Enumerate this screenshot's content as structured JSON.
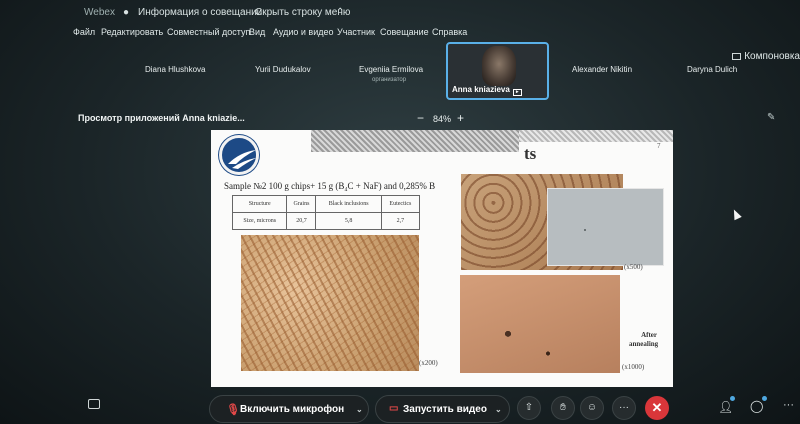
{
  "topbar": {
    "app_name": "Webex",
    "meeting_info": "Информация о совещании",
    "hide_menu": "Скрыть строку меню",
    "hide_menu_chevron": "chevron-up-icon"
  },
  "menubar": {
    "items": [
      "Файл",
      "Редактировать",
      "Совместный доступ",
      "Вид",
      "Аудио и видео",
      "Участник",
      "Совещание",
      "Справка"
    ]
  },
  "layout": {
    "label": "Компоновка",
    "icon": "layout-icon"
  },
  "participants": [
    {
      "name": "Diana Hlushkova",
      "role": ""
    },
    {
      "name": "Yurii Dudukalov",
      "role": ""
    },
    {
      "name": "Evgeniia Ermilova",
      "role": "организатор"
    },
    {
      "name": "Anna kniazieva",
      "role": ""
    },
    {
      "name": "Alexander Nikitin",
      "role": ""
    },
    {
      "name": "Daryna Dulich",
      "role": ""
    }
  ],
  "viewer": {
    "title": "Просмотр приложений Anna kniazie...",
    "zoom_minus": "−",
    "zoom_value": "84%",
    "zoom_plus": "+"
  },
  "slide": {
    "title_fragment": "ts",
    "page_number": "7",
    "sample_text": "Sample №2 100 g chips+ 15 g (B₄C + NaF) and 0,285% B",
    "table": {
      "row1": [
        "Structure",
        "Grains",
        "Black inclusions",
        "Eutectics"
      ],
      "row2": [
        "Size, microns",
        "20,7",
        "5,8",
        "2,7"
      ]
    },
    "caption_main": "(x200)",
    "caption_top_right": "(x500)",
    "caption_after": "After annealing",
    "caption_bottom_right": "(x1000)"
  },
  "controls": {
    "mic_label": "Включить микрофон",
    "video_label": "Запустить видео",
    "icons": [
      "chat-icon",
      "mic-off-icon",
      "video-off-icon",
      "share-icon",
      "hand-icon",
      "reaction-icon",
      "more-icon",
      "end-call-icon",
      "participants-icon",
      "messages-icon",
      "more-options-icon"
    ]
  }
}
